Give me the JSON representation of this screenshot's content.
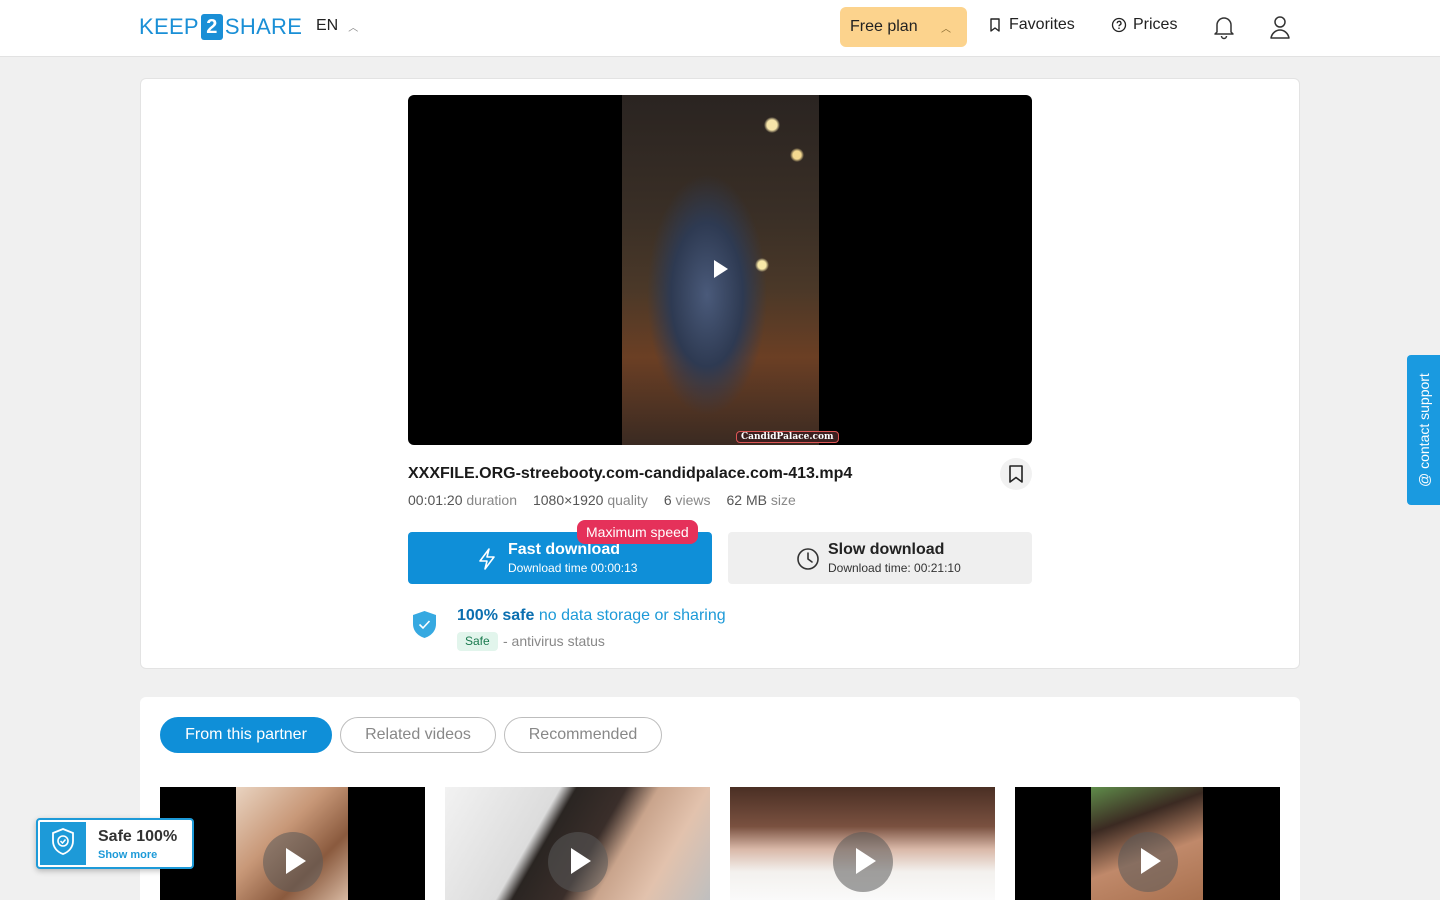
{
  "header": {
    "logo_left": "KEEP",
    "logo_mid": "2",
    "logo_right": "SHARE",
    "language": "EN",
    "plan_label": "Free plan",
    "favorites_label": "Favorites",
    "prices_label": "Prices"
  },
  "player": {
    "watermark": "CandidPalace.com"
  },
  "file": {
    "name": "XXXFILE.ORG-streebooty.com-candidpalace.com-413.mp4",
    "duration_value": "00:01:20",
    "duration_label": "duration",
    "quality_value": "1080×1920",
    "quality_label": "quality",
    "views_value": "6",
    "views_label": "views",
    "size_value": "62 MB",
    "size_label": "size"
  },
  "download": {
    "fast_badge": "Maximum speed",
    "fast_title": "Fast download",
    "fast_sub": "Download time 00:00:13",
    "slow_title": "Slow download",
    "slow_sub": "Download time: 00:21:10"
  },
  "safety": {
    "bold": "100% safe",
    "rest": "no data storage or sharing",
    "tag": "Safe",
    "antivirus": "- antivirus status"
  },
  "tabs": [
    {
      "label": "From this partner",
      "active": true
    },
    {
      "label": "Related videos",
      "active": false
    },
    {
      "label": "Recommended",
      "active": false
    }
  ],
  "support_label": "@ contact support",
  "safe_widget": {
    "title": "Safe 100%",
    "link": "Show more"
  },
  "colors": {
    "brand": "#1a8fd6",
    "fast_button": "#0f8fd8",
    "plan_button": "#fcd38d",
    "max_badge": "#e5315a"
  }
}
